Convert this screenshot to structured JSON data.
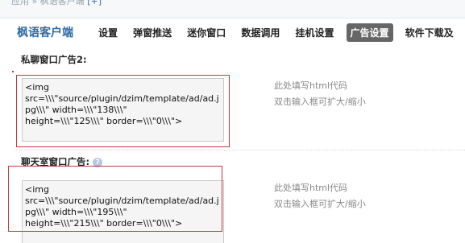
{
  "breadcrumb": {
    "text": "应用 » 枫语客户端",
    "link": "[+]"
  },
  "brand": "枫语客户端",
  "nav": [
    "设置",
    "弹窗推送",
    "迷你窗口",
    "数据调用",
    "挂机设置",
    "广告设置",
    "软件下载及"
  ],
  "active_nav_index": 5,
  "sections": [
    {
      "label": "私聊窗口广告2:",
      "code": "<img\nsrc=\\\\\\\"source/plugin/dzim/template/ad/ad.jpg\\\\\\\" width=\\\\\\\"138\\\\\\\"\nheight=\\\\\\\"125\\\\\\\" border=\\\\\\\"0\\\\\\\">",
      "hint_line1": "此处填写html代码",
      "hint_line2": "双击输入框可扩大/缩小"
    },
    {
      "label": "聊天室窗口广告:",
      "code": "<img\nsrc=\\\\\\\"source/plugin/dzim/template/ad/ad.jpg\\\\\\\" width=\\\\\\\"195\\\\\\\"\nheight=\\\\\\\"215\\\\\\\" border=\\\\\\\"0\\\\\\\">",
      "hint_line1": "此处填写html代码",
      "hint_line2": "双击输入框可扩大/缩小"
    }
  ],
  "colors": {
    "brand": "#2d6aa5",
    "active_tab_bg": "#666666",
    "highlight_frame": "#c8383c"
  }
}
